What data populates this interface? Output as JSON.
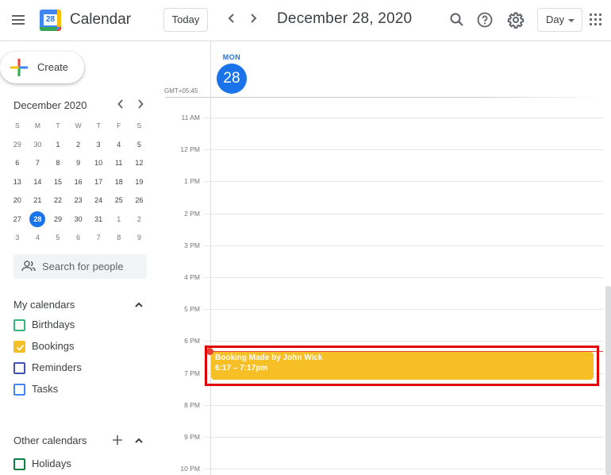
{
  "header": {
    "app_title": "Calendar",
    "logo_day": "28",
    "today_label": "Today",
    "prev_icon": "chevron-left-icon",
    "next_icon": "chevron-right-icon",
    "date_title": "December 28, 2020",
    "icons": [
      "search-icon",
      "help-icon",
      "settings-gear-icon",
      "apps-grid-icon"
    ],
    "view_selector": "Day"
  },
  "sidebar": {
    "create_label": "Create",
    "mini_calendar": {
      "title": "December 2020",
      "weekdays": [
        "S",
        "M",
        "T",
        "W",
        "T",
        "F",
        "S"
      ],
      "weeks": [
        [
          {
            "d": "29",
            "o": true
          },
          {
            "d": "30",
            "o": true
          },
          {
            "d": "1"
          },
          {
            "d": "2"
          },
          {
            "d": "3"
          },
          {
            "d": "4"
          },
          {
            "d": "5"
          }
        ],
        [
          {
            "d": "6"
          },
          {
            "d": "7"
          },
          {
            "d": "8"
          },
          {
            "d": "9"
          },
          {
            "d": "10"
          },
          {
            "d": "11"
          },
          {
            "d": "12"
          }
        ],
        [
          {
            "d": "13"
          },
          {
            "d": "14"
          },
          {
            "d": "15"
          },
          {
            "d": "16"
          },
          {
            "d": "17"
          },
          {
            "d": "18"
          },
          {
            "d": "19"
          }
        ],
        [
          {
            "d": "20"
          },
          {
            "d": "21"
          },
          {
            "d": "22"
          },
          {
            "d": "23"
          },
          {
            "d": "24"
          },
          {
            "d": "25"
          },
          {
            "d": "26"
          }
        ],
        [
          {
            "d": "27"
          },
          {
            "d": "28",
            "sel": true
          },
          {
            "d": "29"
          },
          {
            "d": "30"
          },
          {
            "d": "31"
          },
          {
            "d": "1",
            "o": true
          },
          {
            "d": "2",
            "o": true
          }
        ],
        [
          {
            "d": "3",
            "o": true
          },
          {
            "d": "4",
            "o": true
          },
          {
            "d": "5",
            "o": true
          },
          {
            "d": "6",
            "o": true
          },
          {
            "d": "7",
            "o": true
          },
          {
            "d": "8",
            "o": true
          },
          {
            "d": "9",
            "o": true
          }
        ]
      ]
    },
    "search_people_placeholder": "Search for people",
    "my_calendars": {
      "title": "My calendars",
      "items": [
        {
          "label": "Birthdays",
          "color": "#33b679",
          "checked": false
        },
        {
          "label": "Bookings",
          "color": "#f6bf26",
          "checked": true
        },
        {
          "label": "Reminders",
          "color": "#3f51b5",
          "checked": false
        },
        {
          "label": "Tasks",
          "color": "#4285f4",
          "checked": false
        }
      ]
    },
    "other_calendars": {
      "title": "Other calendars",
      "items": [
        {
          "label": "Holidays",
          "color": "#0b8043",
          "checked": false
        }
      ]
    }
  },
  "main": {
    "day_of_week": "MON",
    "day_number": "28",
    "timezone": "GMT+05:45",
    "hours": [
      "11 AM",
      "12 PM",
      "1 PM",
      "2 PM",
      "3 PM",
      "4 PM",
      "5 PM",
      "6 PM",
      "7 PM",
      "8 PM",
      "9 PM",
      "10 PM"
    ],
    "event": {
      "title": "Booking Made by John Wick",
      "time": "6:17 – 7:17pm",
      "color": "#f6bf26"
    },
    "highlight_color": "#e00000"
  }
}
